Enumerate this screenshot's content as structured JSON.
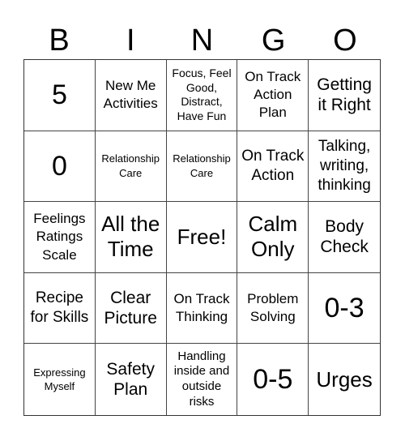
{
  "header": {
    "letters": [
      "B",
      "I",
      "N",
      "G",
      "O"
    ]
  },
  "card": {
    "cells": [
      [
        "5",
        "New Me Activities",
        "Focus, Feel Good, Distract, Have Fun",
        "On Track Action Plan",
        "Getting it Right"
      ],
      [
        "0",
        "Relationship Care",
        "Relationship Care",
        "On Track Action",
        "Talking, writing, thinking"
      ],
      [
        "Feelings Ratings Scale",
        "All the Time",
        "Free!",
        "Calm Only",
        "Body Check"
      ],
      [
        "Recipe for Skills",
        "Clear Picture",
        "On Track Thinking",
        "Problem Solving",
        "0-3"
      ],
      [
        "Expressing Myself",
        "Safety Plan",
        "Handling inside and outside risks",
        "0-5",
        "Urges"
      ]
    ],
    "free_space": "Free!"
  }
}
